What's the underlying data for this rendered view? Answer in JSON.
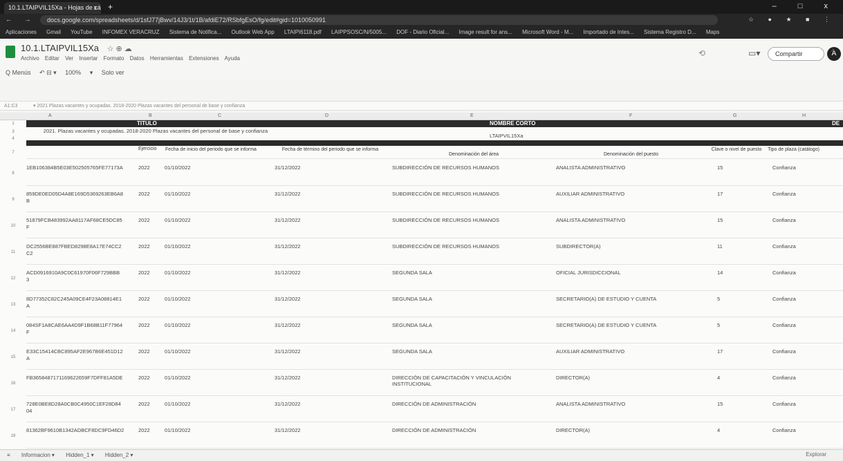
{
  "browser": {
    "tab_title": "10.1.LTAIPVIL15Xa - Hojas de cá",
    "tab_close": "x",
    "new_tab": "+",
    "window_controls": "– □ x",
    "nav_buttons": "← → C",
    "url": "docs.google.com/spreadsheets/d/1sfJ77jBwv/14J3/1t/1B/afdiE72/RSbfgEsO/fg/edit#gid=1010050991",
    "extensions_icons": "☆ ● ★ ■ ⋮",
    "bookmarks": [
      "Aplicaciones",
      "Gmail",
      "YouTube",
      "INFOMEX VERACRUZ",
      "Sistema de Notifica...",
      "Outlook Web App",
      "LTAIPI6118.pdf",
      "LAIPPSOSC/N/5005...",
      "DOF - Diario Oficial...",
      "Image result for ans...",
      "Microsoft Word - M...",
      "Importado de Intes...",
      "Sistema Registro D...",
      "Maps"
    ]
  },
  "doc": {
    "title": "10.1.LTAIPVIL15Xa",
    "title_icons": "☆ ⊕ ☁",
    "menus": [
      "Archivo",
      "Editar",
      "Ver",
      "Insertar",
      "Formato",
      "Datos",
      "Herramientas",
      "Extensiones",
      "Ayuda"
    ],
    "toolbar": [
      "Q Menús",
      "↶ ⊟ ▾",
      "100%",
      "▾",
      "Solo ver"
    ],
    "share_label": "Compartir",
    "avatar_letter": "A",
    "history_icon": "⟲",
    "meet_icon": "▭▾",
    "collapse_icon": "^"
  },
  "formula_bar": {
    "cell_ref": "A1:C3",
    "content": "▾ 2021 Plazas vacantes y ocupadas. 2018-2020 Plazas vacantes del personal de base y confianza"
  },
  "columns": [
    "A",
    "B",
    "C",
    "D",
    "E",
    "F",
    "G",
    "H"
  ],
  "sheet": {
    "titulo_label": "TITULO",
    "nombre_corto_label": "NOMBRE CORTO",
    "desc_label": "DE",
    "titulo_text": "2021. Plazas vacantes y ocupadas. 2018-2020 Plazas vacantes del personal de base y confianza",
    "nombre_corto_text": "LTAIPVIL15Xa",
    "row_numbers_top": [
      "1",
      "3",
      "4",
      "7"
    ],
    "headers": [
      "Ejercicio",
      "Fecha de inicio del periodo que se informa",
      "Fecha de término del periodo que se informa",
      "Denominación del área",
      "Denominación del puesto",
      "Clave o nivel de puesto",
      "Tipo de plaza (catálogo)"
    ],
    "rows": [
      {
        "num": "8",
        "id": "1EB106384B5E03E502505765FE77173A",
        "id2": "",
        "ejercicio": "2022",
        "inicio": "01/10/2022",
        "termino": "31/12/2022",
        "area": "SUBDIRECCIÓN DE RECURSOS HUMANOS",
        "puesto": "ANALISTA ADMINISTRATIVO",
        "clave": "15",
        "tipo": "Confianza"
      },
      {
        "num": "9",
        "id": "859DE0ED05D4A8E169D5369263EB6A8",
        "id2": "B",
        "ejercicio": "2022",
        "inicio": "01/10/2022",
        "termino": "31/12/2022",
        "area": "SUBDIRECCIÓN DE RECURSOS HUMANOS",
        "puesto": "AUXILIAR ADMINISTRATIVO",
        "clave": "17",
        "tipo": "Confianza"
      },
      {
        "num": "10",
        "id": "51879FCB483992AA8117AF68CE5DC85",
        "id2": "F",
        "ejercicio": "2022",
        "inicio": "01/10/2022",
        "termino": "31/12/2022",
        "area": "SUBDIRECCIÓN DE RECURSOS HUMANOS",
        "puesto": "ANALISTA ADMINISTRATIVO",
        "clave": "15",
        "tipo": "Confianza"
      },
      {
        "num": "11",
        "id": "DC2556BE887FBED8298E8A17E74CC2",
        "id2": "C2",
        "ejercicio": "2022",
        "inicio": "01/10/2022",
        "termino": "31/12/2022",
        "area": "SUBDIRECCIÓN DE RECURSOS HUMANOS",
        "puesto": "SUBDIRECTOR(A)",
        "clave": "11",
        "tipo": "Confianza"
      },
      {
        "num": "12",
        "id": "ACD0916910A9C0C61970F06F729BBB",
        "id2": "3",
        "ejercicio": "2022",
        "inicio": "01/10/2022",
        "termino": "31/12/2022",
        "area": "SEGUNDA SALA",
        "puesto": "OFICIAL JURISDICCIONAL",
        "clave": "14",
        "tipo": "Confianza"
      },
      {
        "num": "13",
        "id": "8D77352C82C245A09CE4F23A08814E1",
        "id2": "A",
        "ejercicio": "2022",
        "inicio": "01/10/2022",
        "termino": "31/12/2022",
        "area": "SEGUNDA SALA",
        "puesto": "SECRETARIO(A) DE ESTUDIO Y CUENTA",
        "clave": "5",
        "tipo": "Confianza"
      },
      {
        "num": "14",
        "id": "084SF1A8CAE6AA4D9F1B68B11F77964",
        "id2": "F",
        "ejercicio": "2022",
        "inicio": "01/10/2022",
        "termino": "31/12/2022",
        "area": "SEGUNDA SALA",
        "puesto": "SECRETARIO(A) DE ESTUDIO Y CUENTA",
        "clave": "5",
        "tipo": "Confianza"
      },
      {
        "num": "15",
        "id": "E33C15414CBC895AF2E967B6E451D12",
        "id2": "A",
        "ejercicio": "2022",
        "inicio": "01/10/2022",
        "termino": "31/12/2022",
        "area": "SEGUNDA SALA",
        "puesto": "AUXILIAR ADMINISTRATIVO",
        "clave": "17",
        "tipo": "Confianza"
      },
      {
        "num": "16",
        "id": "FB3658487171169622659F7DFF81A5DE",
        "id2": "",
        "ejercicio": "2022",
        "inicio": "01/10/2022",
        "termino": "31/12/2022",
        "area": "DIRECCIÓN DE CAPACITACIÓN Y VINCULACIÓN INSTITUCIONAL",
        "puesto": "DIRECTOR(A)",
        "clave": "4",
        "tipo": "Confianza"
      },
      {
        "num": "17",
        "id": "728E0BE8D28A0CB0C4950C1EF28D84",
        "id2": "04",
        "ejercicio": "2022",
        "inicio": "01/10/2022",
        "termino": "31/12/2022",
        "area": "DIRECCIÓN DE ADMINISTRACIÓN",
        "puesto": "ANALISTA ADMINISTRATIVO",
        "clave": "15",
        "tipo": "Confianza"
      },
      {
        "num": "18",
        "id": "81362BF9610B1342ADBCF8DC9FD46D2",
        "id2": "",
        "ejercicio": "2022",
        "inicio": "01/10/2022",
        "termino": "31/12/2022",
        "area": "DIRECCIÓN DE ADMINISTRACIÓN",
        "puesto": "DIRECTOR(A)",
        "clave": "4",
        "tipo": "Confianza"
      }
    ]
  },
  "footer": {
    "menu_icon": "≡",
    "sheet_tabs": [
      "Informacion ▾",
      "Hidden_1 ▾",
      "Hidden_2 ▾"
    ],
    "explore": "Explorar"
  }
}
